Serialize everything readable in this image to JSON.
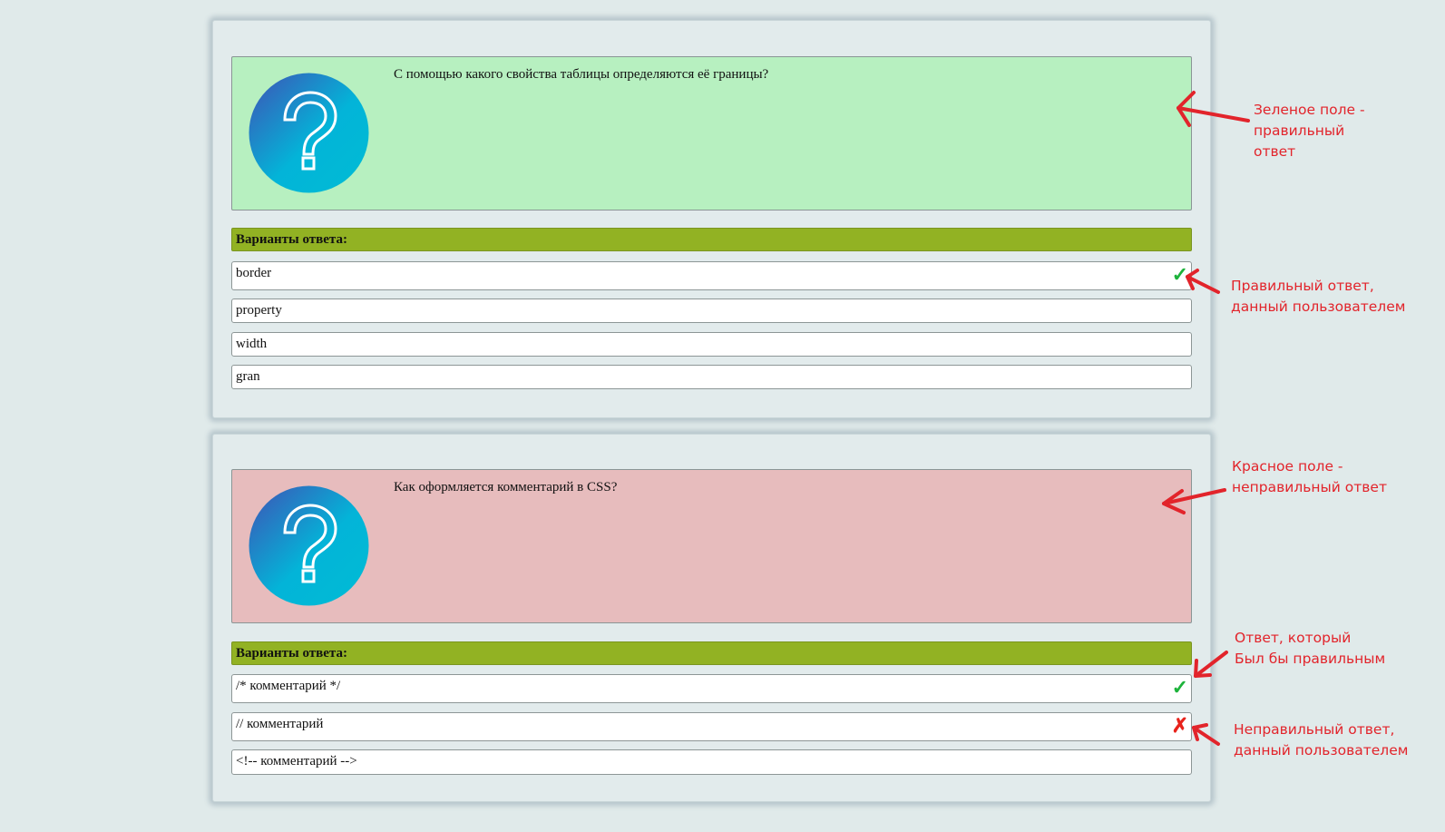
{
  "colors": {
    "correct_bg": "#b7f0c0",
    "wrong_bg": "#e7bcbd",
    "header_bg": "#92b223",
    "check": "#1db33b",
    "cross": "#e8231c",
    "annotation": "#e2242b"
  },
  "question1": {
    "icon": "question-mark-icon",
    "text": "С помощью какого свойства таблицы определяются её границы?",
    "status": "correct",
    "options_header": "Варианты ответа:",
    "options": [
      {
        "label": "border",
        "mark": "✓",
        "mark_icon": "check-icon"
      },
      {
        "label": "property",
        "mark": ""
      },
      {
        "label": "width",
        "mark": ""
      },
      {
        "label": "gran",
        "mark": ""
      }
    ]
  },
  "question2": {
    "icon": "question-mark-icon",
    "text": "Как оформляется комментарий в CSS?",
    "status": "wrong",
    "options_header": "Варианты ответа:",
    "options": [
      {
        "label": "/* комментарий */",
        "mark": "✓",
        "mark_icon": "check-icon"
      },
      {
        "label": "// комментарий",
        "mark": "✗",
        "mark_icon": "cross-icon"
      },
      {
        "label": "<!-- комментарий -->",
        "mark": ""
      }
    ]
  },
  "annotations": {
    "green_field": "Зеленое поле -\nправильный\nответ",
    "correct_user": "Правильный ответ,\nданный пользователем",
    "red_field": "Красное поле -\nнеправильный ответ",
    "would_be_correct": "Ответ, который\nБыл бы правильным",
    "wrong_user": "Неправильный ответ,\nданный пользователем"
  }
}
